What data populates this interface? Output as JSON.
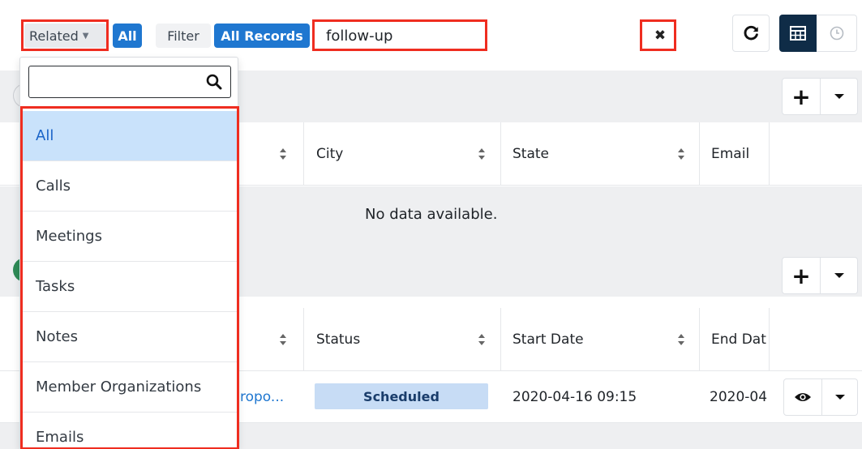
{
  "filter_bar": {
    "module_select": "Related",
    "module_pill": "All",
    "filter_label": "Filter",
    "filter_pill": "All Records",
    "search_value": "follow-up"
  },
  "dropdown": {
    "search_placeholder": "",
    "items": [
      {
        "label": "All",
        "selected": true
      },
      {
        "label": "Calls",
        "selected": false
      },
      {
        "label": "Meetings",
        "selected": false
      },
      {
        "label": "Tasks",
        "selected": false
      },
      {
        "label": "Notes",
        "selected": false
      },
      {
        "label": "Member Organizations",
        "selected": false
      },
      {
        "label": "Emails",
        "selected": false
      }
    ]
  },
  "subpanel_1": {
    "columns": [
      "City",
      "State",
      "Email"
    ],
    "empty_message": "No data available."
  },
  "subpanel_2": {
    "columns": [
      "Status",
      "Start Date",
      "End Dat"
    ],
    "row": {
      "name_fragment": "ropo...",
      "status": "Scheduled",
      "start_date": "2020-04-16 09:15",
      "end_date_fragment": "2020-04"
    }
  },
  "colors": {
    "accent_blue": "#1f77d0",
    "highlight_red": "#ef2d20",
    "selected_bg": "#c9e2fb",
    "active_view": "#0f2c47"
  },
  "icons": [
    "chevron-down-icon",
    "close-icon",
    "refresh-icon",
    "list-view-icon",
    "clock-icon",
    "search-icon",
    "plus-icon",
    "sort-icon",
    "eye-icon"
  ]
}
